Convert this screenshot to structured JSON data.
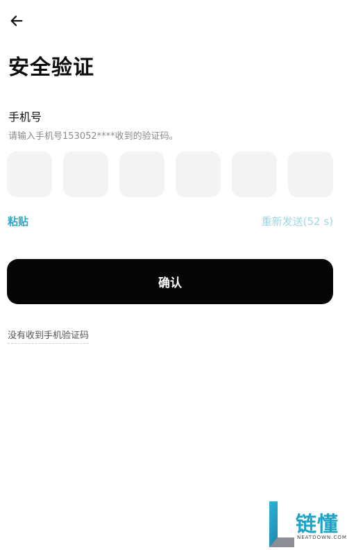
{
  "header": {
    "back_icon": "arrow-left-icon",
    "title": "安全验证"
  },
  "phone_section": {
    "label": "手机号",
    "hint": "请输入手机号153052****收到的验证码。"
  },
  "code_inputs": [
    "",
    "",
    "",
    "",
    "",
    ""
  ],
  "actions": {
    "paste_label": "粘贴",
    "resend_label": "重新发送(52 s)"
  },
  "confirm_label": "确认",
  "no_code_label": "没有收到手机验证码",
  "watermark": {
    "title": "链懂",
    "subtitle": "NEATDOWN.COM"
  },
  "colors": {
    "accent": "#2fa7c2",
    "accent_disabled": "#9ed6e3",
    "button_bg": "#050505",
    "input_bg": "#f2f3f5"
  }
}
